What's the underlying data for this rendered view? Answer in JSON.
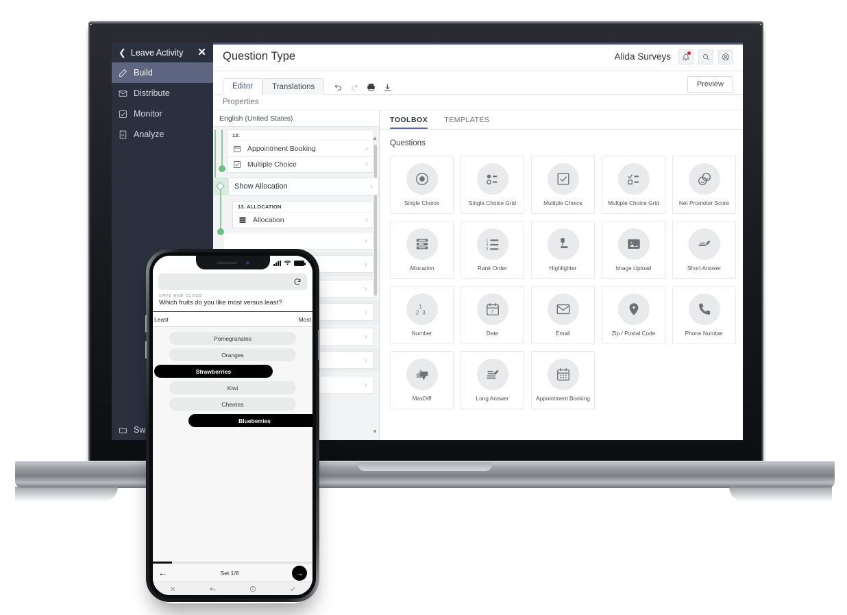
{
  "sidebar": {
    "back_label": "Leave Activity",
    "close_label": "✕",
    "items": [
      {
        "label": "Build",
        "icon": "pencil-icon"
      },
      {
        "label": "Distribute",
        "icon": "envelope-icon"
      },
      {
        "label": "Monitor",
        "icon": "monitor-icon"
      },
      {
        "label": "Analyze",
        "icon": "chart-document-icon"
      }
    ],
    "bottom_label": "Switc",
    "bg_color": "#2b303e",
    "active_color": "#5d6580"
  },
  "topbar": {
    "page_title": "Question Type",
    "brand": "Alida Surveys",
    "notification_badge": true,
    "icons": [
      "bell-icon",
      "search-icon",
      "account-icon"
    ]
  },
  "tabs": {
    "editor": "Editor",
    "translations": "Translations",
    "preview": "Preview",
    "tool_icons": [
      "undo-icon",
      "redo-icon",
      "print-icon",
      "download-icon"
    ]
  },
  "properties_label": "Properties",
  "left_pane": {
    "language": "English (United States)",
    "question_group": {
      "number": "12.",
      "rows": [
        {
          "label": "Appointment Booking",
          "icon": "calendar-icon"
        },
        {
          "label": "Multiple Choice",
          "icon": "checkbox-icon"
        }
      ]
    },
    "action": {
      "label": "Show Allocation"
    },
    "allocation_group": {
      "number": "13. ALLOCATION",
      "rows": [
        {
          "label": "Allocation",
          "icon": "allocation-icon"
        }
      ]
    }
  },
  "toolbox": {
    "tabs": [
      {
        "label": "TOOLBOX",
        "active": true
      },
      {
        "label": "TEMPLATES",
        "active": false
      }
    ],
    "section_title": "Questions",
    "question_types": [
      {
        "label": "Single Choice",
        "icon": "radio-selected-icon"
      },
      {
        "label": "Single Choice Grid",
        "icon": "radio-grid-icon"
      },
      {
        "label": "Multiple Choice",
        "icon": "checkbox-icon"
      },
      {
        "label": "Multiple Choice Grid",
        "icon": "checkbox-grid-icon"
      },
      {
        "label": "Net Promoter Score",
        "icon": "smiley-faces-icon"
      },
      {
        "label": "Allocation",
        "icon": "allocation-icon"
      },
      {
        "label": "Rank Order",
        "icon": "numbered-list-icon"
      },
      {
        "label": "Highlighter",
        "icon": "highlighter-icon"
      },
      {
        "label": "Image Upload",
        "icon": "image-icon"
      },
      {
        "label": "Short Answer",
        "icon": "short-answer-icon"
      },
      {
        "label": "Number",
        "icon": "number-123-icon"
      },
      {
        "label": "Date",
        "icon": "calendar-7-icon"
      },
      {
        "label": "Email",
        "icon": "envelope-icon"
      },
      {
        "label": "Zip / Postal Code",
        "icon": "map-pin-icon"
      },
      {
        "label": "Phone Number",
        "icon": "phone-icon"
      },
      {
        "label": "MaxDiff",
        "icon": "thumbs-updown-icon"
      },
      {
        "label": "Long Answer",
        "icon": "long-answer-icon"
      },
      {
        "label": "Appointment Booking",
        "icon": "calendar-icon"
      }
    ]
  },
  "phone": {
    "status": {
      "signal": "signal-icon",
      "wifi": "wifi-icon",
      "battery": "battery-icon"
    },
    "refresh_icon": "refresh-icon",
    "save_and_close": "SAVE AND CLOSE",
    "question": "Which fruits do you like most versus least?",
    "scale_left": "Least",
    "scale_right": "Most",
    "options": [
      {
        "label": "Pomegranates",
        "selected": false,
        "align": "center"
      },
      {
        "label": "Oranges",
        "selected": false,
        "align": "center"
      },
      {
        "label": "Strawberries",
        "selected": true,
        "align": "left"
      },
      {
        "label": "Kiwi",
        "selected": false,
        "align": "center"
      },
      {
        "label": "Cherries",
        "selected": false,
        "align": "center"
      },
      {
        "label": "Blueberries",
        "selected": true,
        "align": "right"
      }
    ],
    "progress_percent": 12,
    "nav": {
      "prev": "←",
      "label": "Set 1/8",
      "next": "→"
    },
    "sysbar_icons": [
      "close-icon",
      "back-icon",
      "info-icon",
      "check-icon"
    ]
  }
}
